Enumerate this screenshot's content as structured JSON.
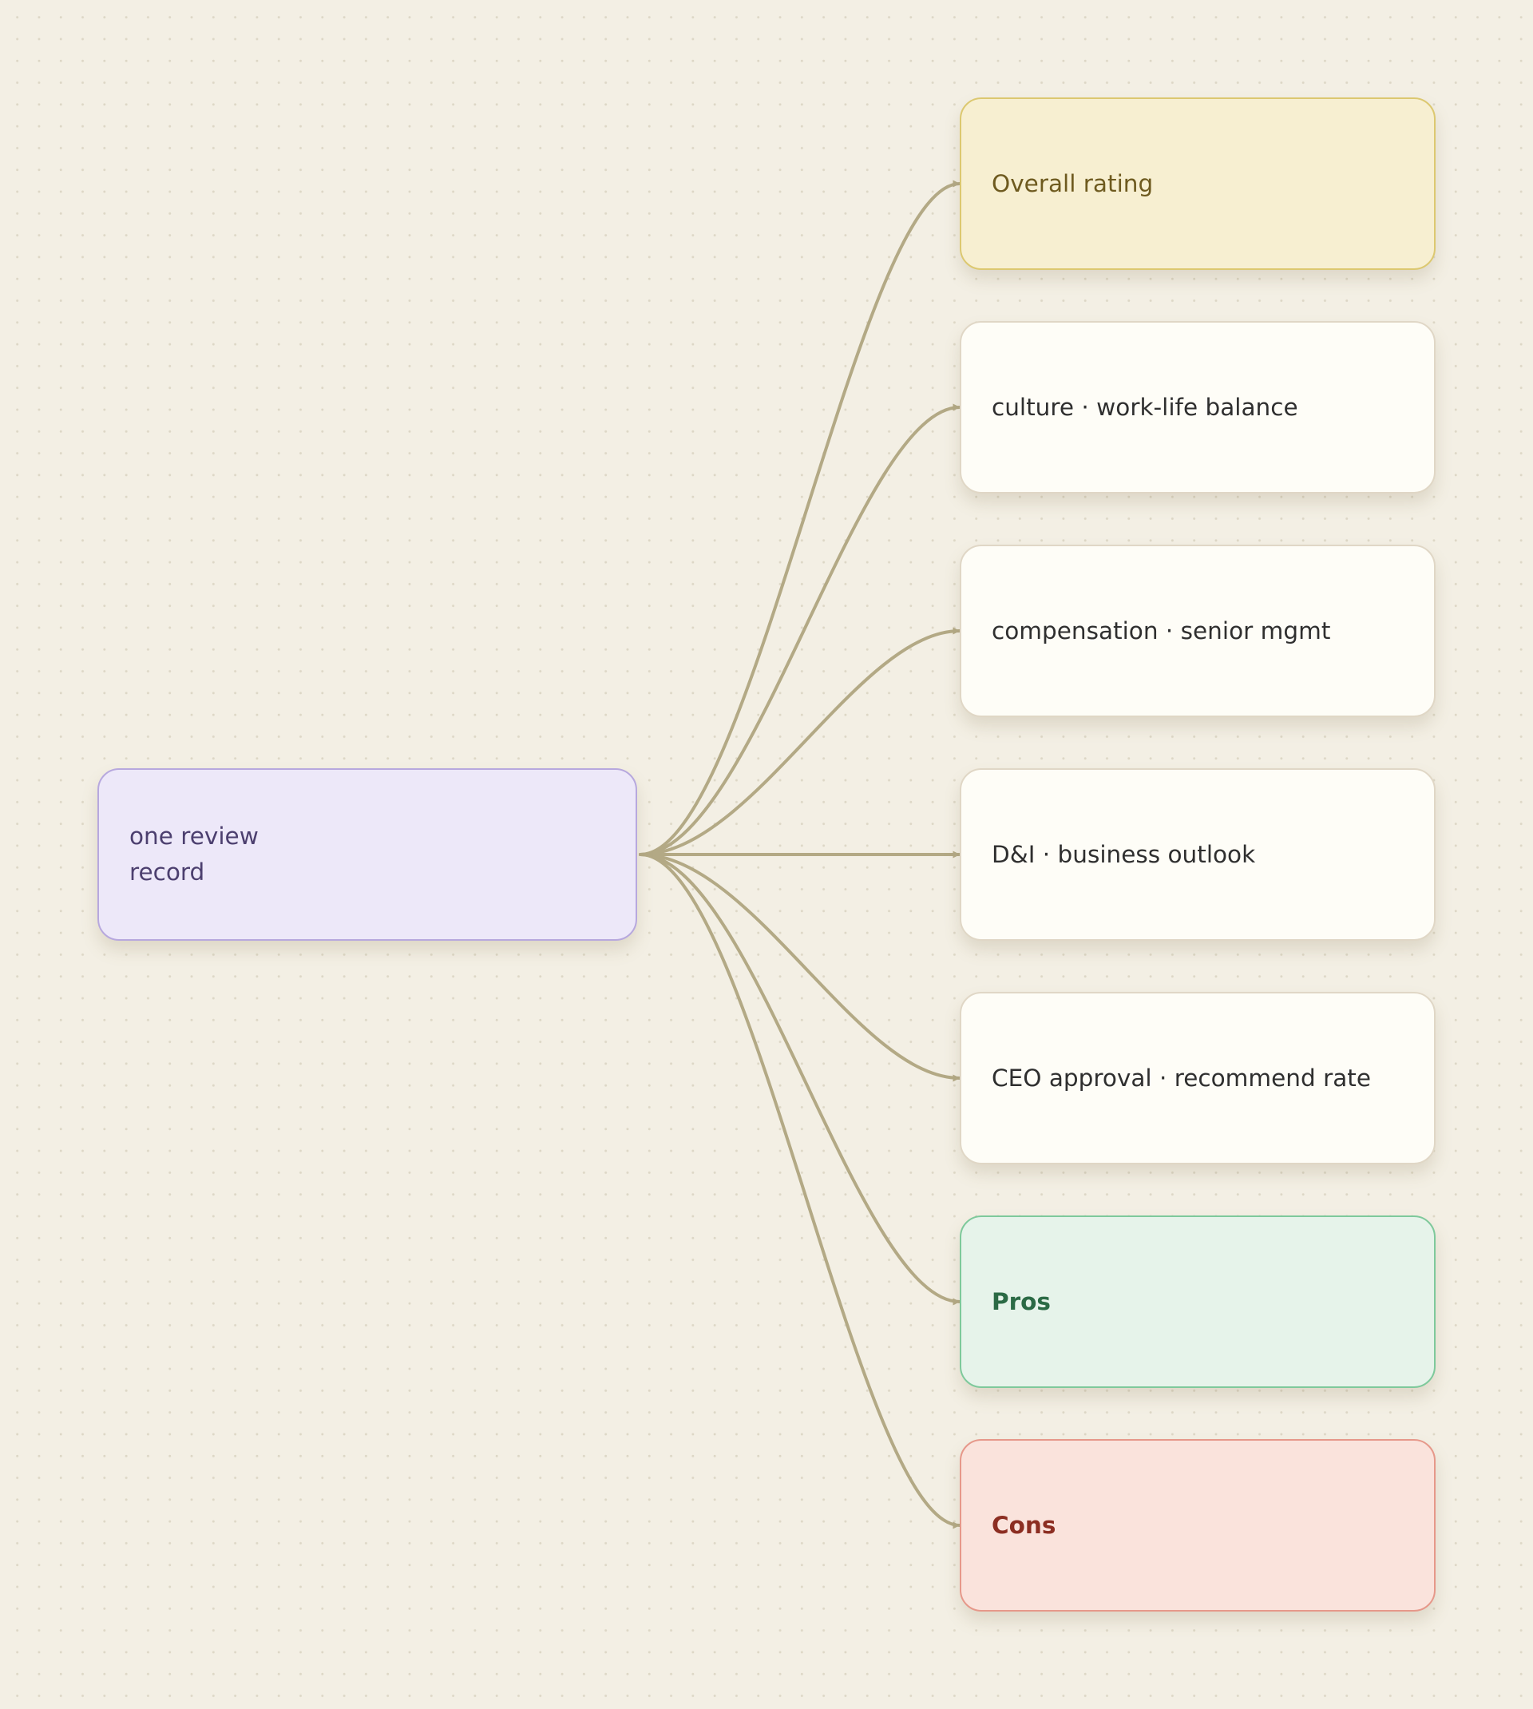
{
  "diagram": {
    "source": {
      "label": "one review record"
    },
    "targets": [
      {
        "label": "Overall rating",
        "style": "yellow"
      },
      {
        "label": "culture · work-life balance",
        "style": "white"
      },
      {
        "label": "compensation · senior mgmt",
        "style": "white"
      },
      {
        "label": "D&I · business outlook",
        "style": "white"
      },
      {
        "label": "CEO approval · recommend rate",
        "style": "white"
      },
      {
        "label": "Pros",
        "style": "green"
      },
      {
        "label": "Cons",
        "style": "red"
      }
    ],
    "colors": {
      "edge": "#b3a985",
      "canvas": "#f3efe4",
      "source_fill": "#ede8f9",
      "source_border": "#b7a8de",
      "yellow_fill": "#f7efd1",
      "green_fill": "#e6f3ea",
      "red_fill": "#fae3dc"
    },
    "icons": {
      "edge_end": "arrowhead-icon"
    }
  }
}
